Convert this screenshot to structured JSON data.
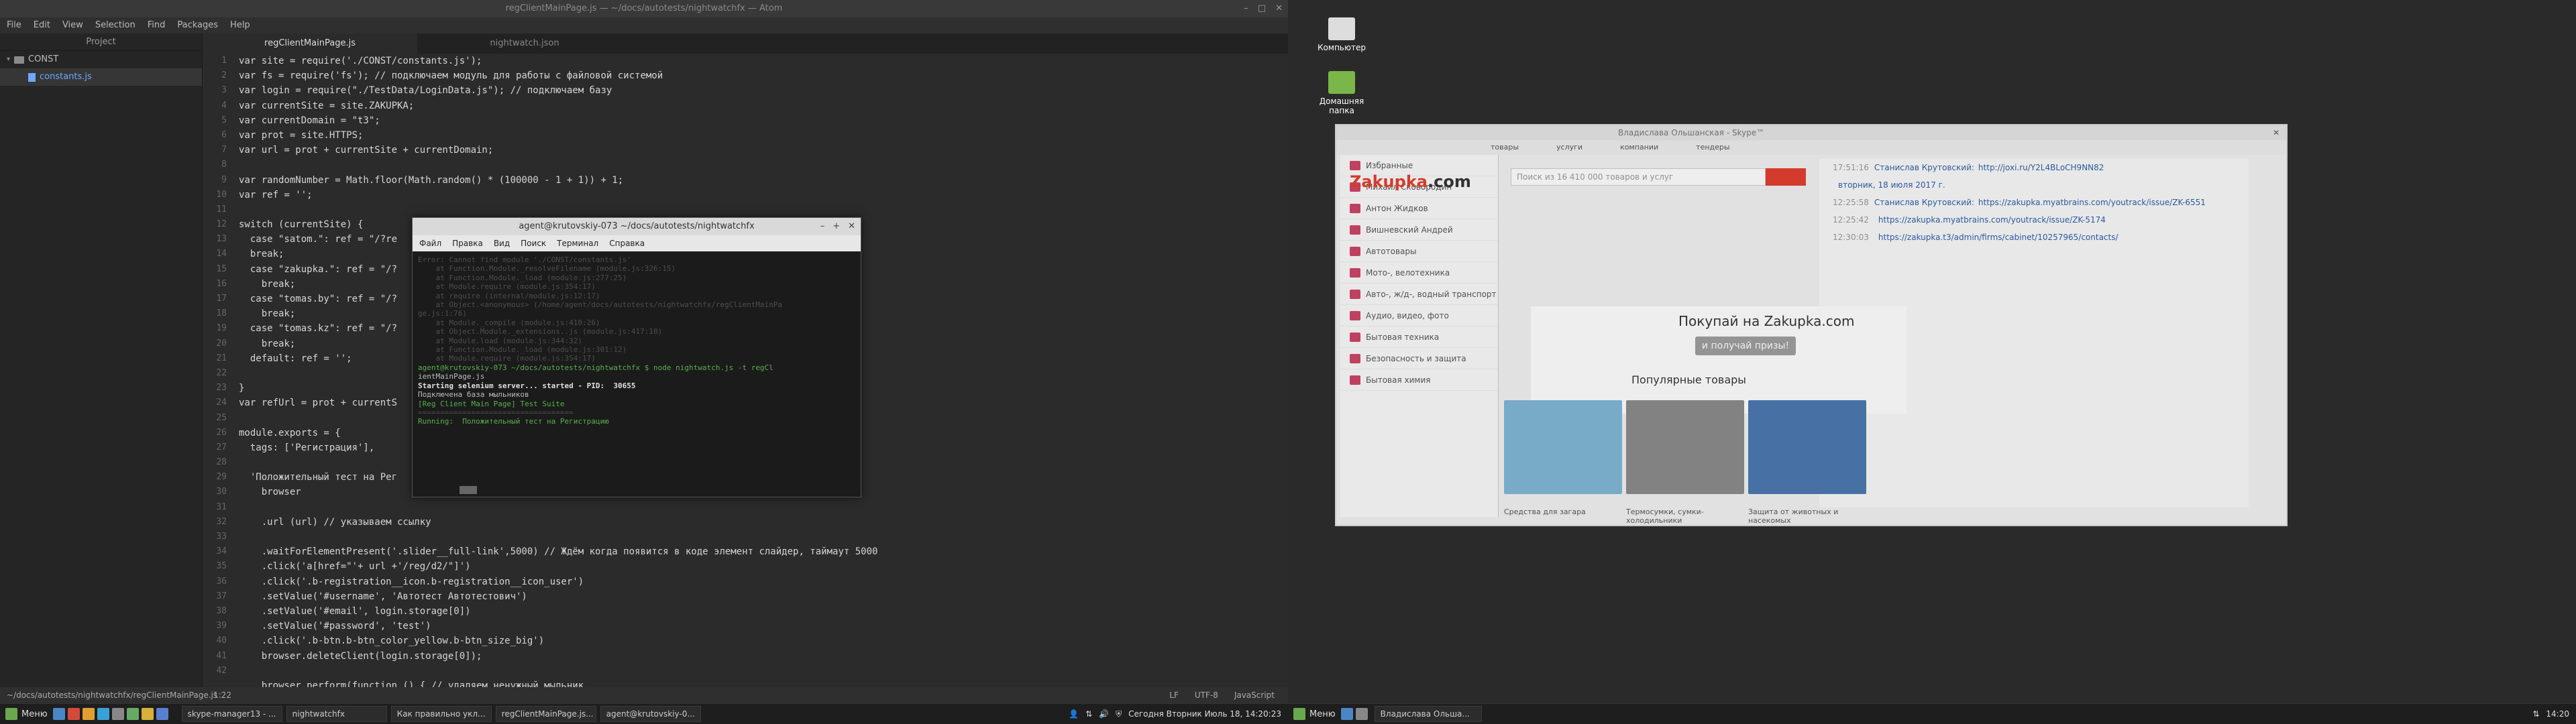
{
  "atom": {
    "title": "regClientMainPage.js — ~/docs/autotests/nightwatchfx — Atom",
    "menu": [
      "File",
      "Edit",
      "View",
      "Selection",
      "Find",
      "Packages",
      "Help"
    ],
    "project_header": "Project",
    "tree": [
      {
        "label": "CONST"
      },
      {
        "label": "constants.js"
      }
    ],
    "tabs": [
      "regClientMainPage.js",
      "nightwatch.json"
    ],
    "line_numbers": [
      "1",
      "2",
      "3",
      "4",
      "5",
      "6",
      "7",
      "8",
      "9",
      "10",
      "11",
      "12",
      "13",
      "14",
      "15",
      "16",
      "17",
      "18",
      "19",
      "20",
      "21",
      "22",
      "23",
      "24",
      "25",
      "26",
      "27",
      "28",
      "29",
      "30",
      "31",
      "32",
      "33",
      "34",
      "35",
      "36",
      "37",
      "38",
      "39",
      "40",
      "41",
      "42"
    ],
    "code": [
      "var site = require('./CONST/constants.js');",
      "var fs = require('fs'); // подключаем модуль для работы с файловой системой",
      "var login = require(\"./TestData/LoginData.js\"); // подключаем базу",
      "var currentSite = site.ZAKUPKA;",
      "var currentDomain = \"t3\";",
      "var prot = site.HTTPS;",
      "var url = prot + currentSite + currentDomain;",
      "",
      "var randomNumber = Math.floor(Math.random() * (100000 - 1 + 1)) + 1;",
      "var ref = '';",
      "",
      "switch (currentSite) {",
      "  case \"satom.\": ref = \"/?re",
      "  break;",
      "  case \"zakupka.\": ref = \"/?",
      "    break;",
      "  case \"tomas.by\": ref = \"/?",
      "    break;",
      "  case \"tomas.kz\": ref = \"/?",
      "    break;",
      "  default: ref = '';",
      "",
      "}",
      "var refUrl = prot + currentS",
      "",
      "module.exports = {",
      "  tags: ['Регистрация'],",
      "",
      "  'Положительный тест на Рег",
      "    browser",
      "",
      "    .url (url) // указываем ссылку",
      "",
      "    .waitForElementPresent('.slider__full-link',5000) // Ждём когда появится в коде элемент слайдер, таймаут 5000",
      "    .click('a[href=\"'+ url +'/reg/d2/\"]')",
      "    .click('.b-registration__icon.b-registration__icon_user')",
      "    .setValue('#username', 'Автотест Автотестович')",
      "    .setValue('#email', login.storage[0])",
      "    .setValue('#password', 'test')",
      "    .click('.b-btn.b-btn_color_yellow.b-btn_size_big')",
      "    browser.deleteClient(login.storage[0]);",
      "",
      "    browser.perform(function () { // удаляем ненужный мыльник"
    ],
    "status": {
      "path": "~/docs/autotests/nightwatchfx/regClientMainPage.js",
      "cursor": "1:22",
      "eol": "LF",
      "encoding": "UTF-8",
      "grammar": "JavaScript"
    }
  },
  "terminal": {
    "title": "agent@krutovskiy-073 ~/docs/autotests/nightwatchfx",
    "menu": [
      "Файл",
      "Правка",
      "Вид",
      "Поиск",
      "Терминал",
      "Справка"
    ],
    "lines": [
      {
        "t": "Error: Cannot find module './CONST/constants.js'",
        "c": "dim"
      },
      {
        "t": "    at Function.Module._resolveFilename (module.js:326:15)",
        "c": "dim"
      },
      {
        "t": "    at Function.Module._load (module.js:277:25)",
        "c": "dim"
      },
      {
        "t": "    at Module.require (module.js:354:17)",
        "c": "dim"
      },
      {
        "t": "    at require (internal/module.js:12:17)",
        "c": "dim"
      },
      {
        "t": "    at Object.<anonymous> (/home/agent/docs/autotests/nightwatchfx/regClientMainPa",
        "c": "dim"
      },
      {
        "t": "ge.js:1:76)",
        "c": "dim"
      },
      {
        "t": "    at Module._compile (module.js:410:26)",
        "c": "dim"
      },
      {
        "t": "    at Object.Module._extensions..js (module.js:417:10)",
        "c": "dim"
      },
      {
        "t": "    at Module.load (module.js:344:32)",
        "c": "dim"
      },
      {
        "t": "    at Function.Module._load (module.js:301:12)",
        "c": "dim"
      },
      {
        "t": "    at Module.require (module.js:354:17)",
        "c": "dim"
      },
      {
        "t": "",
        "c": ""
      },
      {
        "t": "agent@krutovskiy-073 ~/docs/autotests/nightwatchfx $ node nightwatch.js -t regCl",
        "c": "g"
      },
      {
        "t": "ientMainPage.js",
        "c": ""
      },
      {
        "t": "Starting selenium server... started - PID:  30655",
        "c": "b"
      },
      {
        "t": "Подключена база мыльников",
        "c": ""
      },
      {
        "t": "",
        "c": ""
      },
      {
        "t": "[Reg Client Main Page] Test Suite",
        "c": "g"
      },
      {
        "t": "===================================",
        "c": "dim"
      },
      {
        "t": "",
        "c": ""
      },
      {
        "t": "Running:  Положительный тест на Регистрацию",
        "c": "g"
      }
    ]
  },
  "desktop": {
    "icons": [
      "Компьютер",
      "Домашняя папка"
    ]
  },
  "browser": {
    "title": "Владислава Ольшанская - Skype™",
    "nav": [
      "товары",
      "услуги",
      "компании",
      "тендеры"
    ],
    "logo_left": "Zakupka",
    "logo_right": ".com",
    "search_placeholder": "Поиск из 16 410 000 товаров и услуг",
    "sidebar": [
      "Избранные",
      "Михаил Сковородин",
      "Антон Жидков",
      "Вишневский Андрей",
      "Автотовары",
      "Мото-, велотехника",
      "Авто-, ж/д-, водный транспорт",
      "Аудио, видео, фото",
      "Бытовая техника",
      "Безопасность и защита",
      "Бытовая химия"
    ],
    "promo_text": "Покупай на  Zakupka.com",
    "promo_button": "и получай призы!",
    "popular": "Популярные товары",
    "cards": [
      "Средства для загара",
      "Термосумки, сумки-холодильники",
      "Защита от животных и насекомых"
    ],
    "chat": [
      {
        "time": "17:51:16",
        "name": "Станислав Крутовский:",
        "link": "http://joxi.ru/Y2L4BLoCH9NN82"
      },
      {
        "time": "",
        "name": "вторник, 18 июля 2017 г.",
        "link": ""
      },
      {
        "time": "12:25:58",
        "name": "Станислав Крутовский:",
        "link": "https://zakupka.myatbrains.com/youtrack/issue/ZK-6551"
      },
      {
        "time": "12:25:42",
        "name": "",
        "link": "https://zakupka.myatbrains.com/youtrack/issue/ZK-5174"
      },
      {
        "time": "12:30:03",
        "name": "",
        "link": "https://zakupka.t3/admin/firms/cabinet/10257965/contacts/"
      }
    ]
  },
  "taskbar_left": {
    "menu": "Меню",
    "tasks": [
      "skype-manager13 - ...",
      "nightwatchfx",
      "Как правильно укл...",
      "regClientMainPage.js...",
      "agent@krutovskiy-0..."
    ],
    "clock": "Сегодня Вторник Июль 18, 14:20:23"
  },
  "taskbar_right": {
    "menu": "Меню",
    "tasks": [
      "Владислава Ольша..."
    ],
    "clock": "14:20"
  }
}
